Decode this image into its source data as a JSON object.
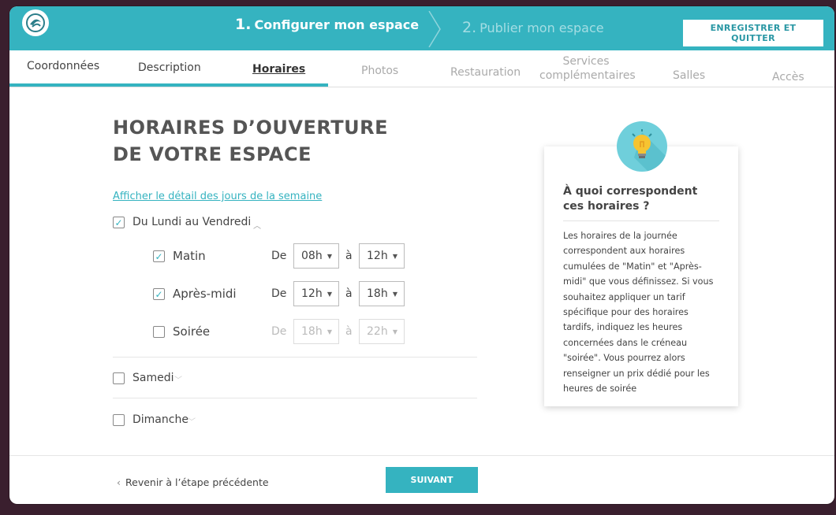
{
  "header": {
    "step1_num": "1.",
    "step1_label": "Configurer mon espace",
    "step2_num": "2.",
    "step2_label": "Publier mon espace",
    "save_label": "ENREGISTRER ET QUITTER"
  },
  "tabs": [
    {
      "label": "Coordonnées"
    },
    {
      "label": "Description"
    },
    {
      "label": "Horaires"
    },
    {
      "label": "Photos"
    },
    {
      "label": "Restauration"
    },
    {
      "label": "Services complémentaires"
    },
    {
      "label": "Salles"
    },
    {
      "label": "Accès"
    }
  ],
  "main": {
    "title_line1": "HORAIRES D’OUVERTURE",
    "title_line2": "DE VOTRE ESPACE",
    "detail_link": "Afficher le détail des jours de la semaine",
    "group_weekdays": "Du Lundi au Vendredi",
    "slots": [
      {
        "label": "Matin",
        "de": "De",
        "a": "à",
        "from": "08h",
        "to": "12h"
      },
      {
        "label": "Après-midi",
        "de": "De",
        "a": "à",
        "from": "12h",
        "to": "18h"
      },
      {
        "label": "Soirée",
        "de": "De",
        "a": "à",
        "from": "18h",
        "to": "22h"
      }
    ],
    "saturday": "Samedi",
    "sunday": "Dimanche"
  },
  "info": {
    "title": "À quoi correspondent ces horaires ?",
    "body": "Les horaires de la journée correspondent aux horaires cumulées de \"Matin\" et \"Après-midi\" que vous définissez. Si vous souhaitez appliquer un tarif spécifique pour des horaires tardifs, indiquez les heures concernées dans le créneau \"soirée\". Vous pourrez alors renseigner un prix dédié pour les heures de soirée"
  },
  "footer": {
    "back_label": "Revenir à l’étape précédente",
    "next_label": "SUIVANT"
  },
  "colors": {
    "accent": "#35b3c0"
  }
}
